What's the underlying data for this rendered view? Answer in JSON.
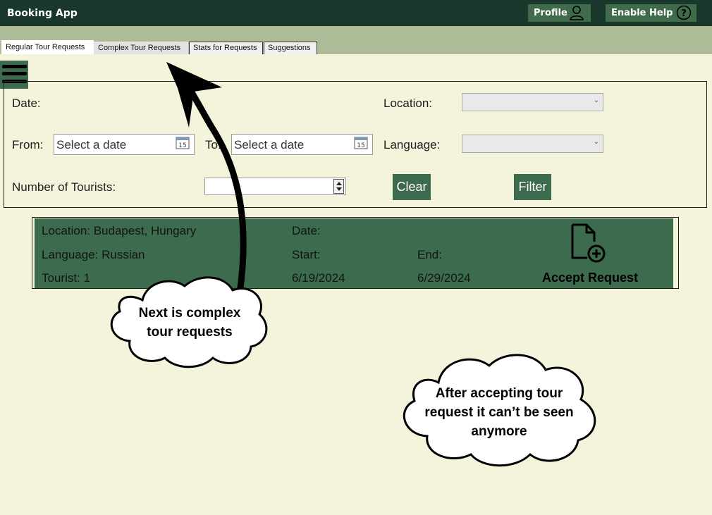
{
  "window": {
    "title": "Booking App"
  },
  "titlebar": {
    "profile_label": "Profile",
    "help_label": "Enable Help",
    "help_glyph": "?"
  },
  "tabs": [
    {
      "label": "Regular Tour Requests",
      "state": "active"
    },
    {
      "label": "Complex Tour Requests",
      "state": "hover"
    },
    {
      "label": "Stats for Requests"
    },
    {
      "label": "Suggestions"
    }
  ],
  "filters": {
    "date_label": "Date:",
    "from_label": "From:",
    "from_placeholder": "Select a date",
    "to_label": "To:",
    "to_placeholder": "Select a date",
    "calendar_glyph": "15",
    "location_label": "Location:",
    "location_value": "",
    "language_label": "Language:",
    "language_value": "",
    "tourists_label": "Number of Tourists:",
    "tourists_value": "",
    "clear_label": "Clear",
    "filter_label": "Filter"
  },
  "request_card": {
    "location": "Location: Budapest, Hungary",
    "language": "Language: Russian",
    "tourists": "Tourist: 1",
    "date_label": "Date:",
    "start_label": "Start:",
    "end_label": "End:",
    "start_value": "6/19/2024",
    "end_value": "6/29/2024",
    "accept_label": "Accept Request"
  },
  "annotations": {
    "bubble1": "Next is complex tour requests",
    "bubble2": "After accepting tour request it can’t be seen anymore"
  },
  "colors": {
    "titlebar": "#19382b",
    "tabstrip": "#adbb97",
    "background": "#f4f4dc",
    "accent_green": "#3d6b4d"
  },
  "icons": [
    "user-icon",
    "help-circle-icon",
    "hamburger-menu-icon",
    "calendar-icon",
    "chevron-down-icon",
    "spin-up-icon",
    "spin-down-icon",
    "document-add-icon"
  ]
}
